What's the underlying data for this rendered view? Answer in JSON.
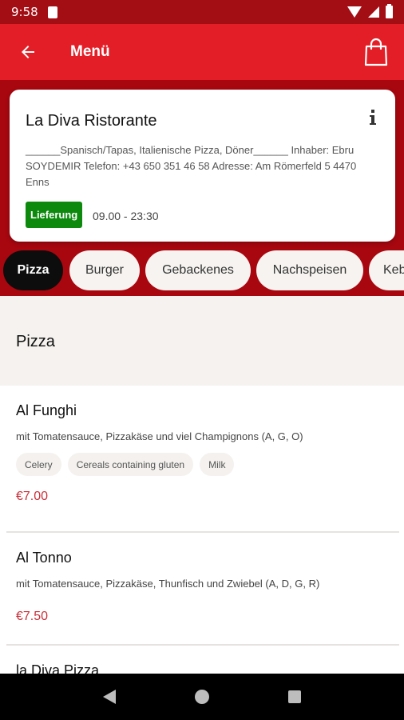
{
  "status_bar": {
    "time": "9:58"
  },
  "app_bar": {
    "title": "Menü"
  },
  "restaurant": {
    "name": "La Diva Ristorante",
    "description": "______Spanisch/Tapas, Italienische Pizza, Döner______  Inhaber: Ebru SOYDEMIR Telefon: +43 650 351 46 58 Adresse: Am Römerfeld 5 4470 Enns",
    "delivery_badge": "Lieferung",
    "hours": "09.00 - 23:30"
  },
  "categories": [
    {
      "label": "Pizza",
      "active": true
    },
    {
      "label": "Burger",
      "active": false
    },
    {
      "label": "Gebackenes",
      "active": false
    },
    {
      "label": "Nachspeisen",
      "active": false
    },
    {
      "label": "Keb",
      "active": false
    }
  ],
  "section": {
    "title": "Pizza"
  },
  "items": [
    {
      "name": "Al Funghi",
      "description": "mit Tomatensauce, Pizzakäse und viel Champignons (A, G, O)",
      "allergens": [
        "Celery",
        "Cereals containing gluten",
        "Milk"
      ],
      "price": "€7.00"
    },
    {
      "name": "Al Tonno",
      "description": "mit Tomatensauce, Pizzakäse, Thunfisch und Zwiebel (A, D, G, R)",
      "allergens": [],
      "price": "€7.50"
    },
    {
      "name": "la Diva Pizza",
      "description": "",
      "allergens": [],
      "price": ""
    }
  ],
  "colors": {
    "status_bar": "#a30d14",
    "app_bar": "#e41e26",
    "accent_band": "#a8070f",
    "delivery_green": "#0d8a0d",
    "price_red": "#c8303a",
    "active_tab": "#0d0d0d"
  },
  "icons": {
    "back": "arrow-left-icon",
    "cart": "shopping-bag-icon",
    "info": "info-icon"
  }
}
